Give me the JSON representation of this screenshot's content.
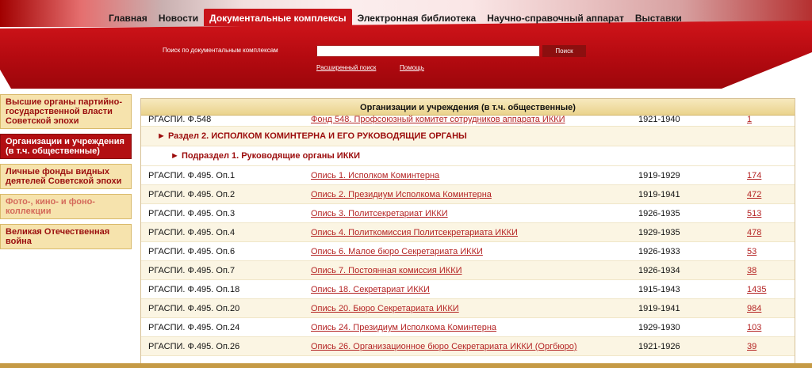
{
  "nav": {
    "items": [
      {
        "label": "Главная",
        "active": false
      },
      {
        "label": "Новости",
        "active": false
      },
      {
        "label": "Документальные комплексы",
        "active": true
      },
      {
        "label": "Электронная библиотека",
        "active": false
      },
      {
        "label": "Научно-справочный аппарат",
        "active": false
      },
      {
        "label": "Выставки",
        "active": false
      }
    ]
  },
  "search": {
    "label": "Поиск по документальным комплексам",
    "value": "",
    "button": "Поиск",
    "advanced": "Расширенный поиск",
    "help": "Помощь"
  },
  "sidebar": {
    "items": [
      {
        "label": "Высшие органы партийно-государственной власти Советской эпохи",
        "state": "normal"
      },
      {
        "label": "Организации и учреждения (в т.ч. общественные)",
        "state": "active"
      },
      {
        "label": "Личные фонды видных деятелей Советской эпохи",
        "state": "normal"
      },
      {
        "label": "Фото-, кино- и фоно-коллекции",
        "state": "muted"
      },
      {
        "label": "Великая Отечественная война",
        "state": "normal"
      }
    ]
  },
  "table": {
    "title": "Организации и учреждения (в т.ч. общественные)",
    "first_row": {
      "code": "РГАСПИ. Ф.548",
      "title": "Фонд 548. Профсоюзный комитет сотрудников аппарата ИККИ",
      "years": "1921-1940",
      "count": "1"
    },
    "section": "► Раздел 2. ИСПОЛКОМ КОМИНТЕРНА И ЕГО РУКОВОДЯЩИЕ ОРГАНЫ",
    "subsection": "► Подраздел 1. Руководящие органы ИККИ",
    "rows": [
      {
        "code": "РГАСПИ. Ф.495. Оп.1",
        "title": "Опись 1. Исполком Коминтерна",
        "years": "1919-1929",
        "count": "174"
      },
      {
        "code": "РГАСПИ. Ф.495. Оп.2",
        "title": "Опись 2. Президиум Исполкома Коминтерна",
        "years": "1919-1941",
        "count": "472"
      },
      {
        "code": "РГАСПИ. Ф.495. Оп.3",
        "title": "Опись 3. Политсекретариат ИККИ",
        "years": "1926-1935",
        "count": "513"
      },
      {
        "code": "РГАСПИ. Ф.495. Оп.4",
        "title": "Опись 4. Политкомиссия Политсекретариата ИККИ",
        "years": "1929-1935",
        "count": "478"
      },
      {
        "code": "РГАСПИ. Ф.495. Оп.6",
        "title": "Опись 6. Малое бюро Секретариата ИККИ",
        "years": "1926-1933",
        "count": "53"
      },
      {
        "code": "РГАСПИ. Ф.495. Оп.7",
        "title": "Опись 7. Постоянная комиссия ИККИ",
        "years": "1926-1934",
        "count": "38"
      },
      {
        "code": "РГАСПИ. Ф.495. Оп.18",
        "title": "Опись 18. Секретариат ИККИ",
        "years": "1915-1943",
        "count": "1435"
      },
      {
        "code": "РГАСПИ. Ф.495. Оп.20",
        "title": "Опись 20. Бюро Секретариата ИККИ",
        "years": "1919-1941",
        "count": "984"
      },
      {
        "code": "РГАСПИ. Ф.495. Оп.24",
        "title": "Опись 24. Президиум Исполкома Коминтерна",
        "years": "1929-1930",
        "count": "103"
      },
      {
        "code": "РГАСПИ. Ф.495. Оп.26",
        "title": "Опись 26. Организационное бюро Секретариата ИККИ (Оргбюро)",
        "years": "1921-1926",
        "count": "39"
      }
    ]
  },
  "colors": {
    "brand_red": "#c8141a",
    "link_red": "#b42323",
    "gold": "#f6e3ad"
  }
}
